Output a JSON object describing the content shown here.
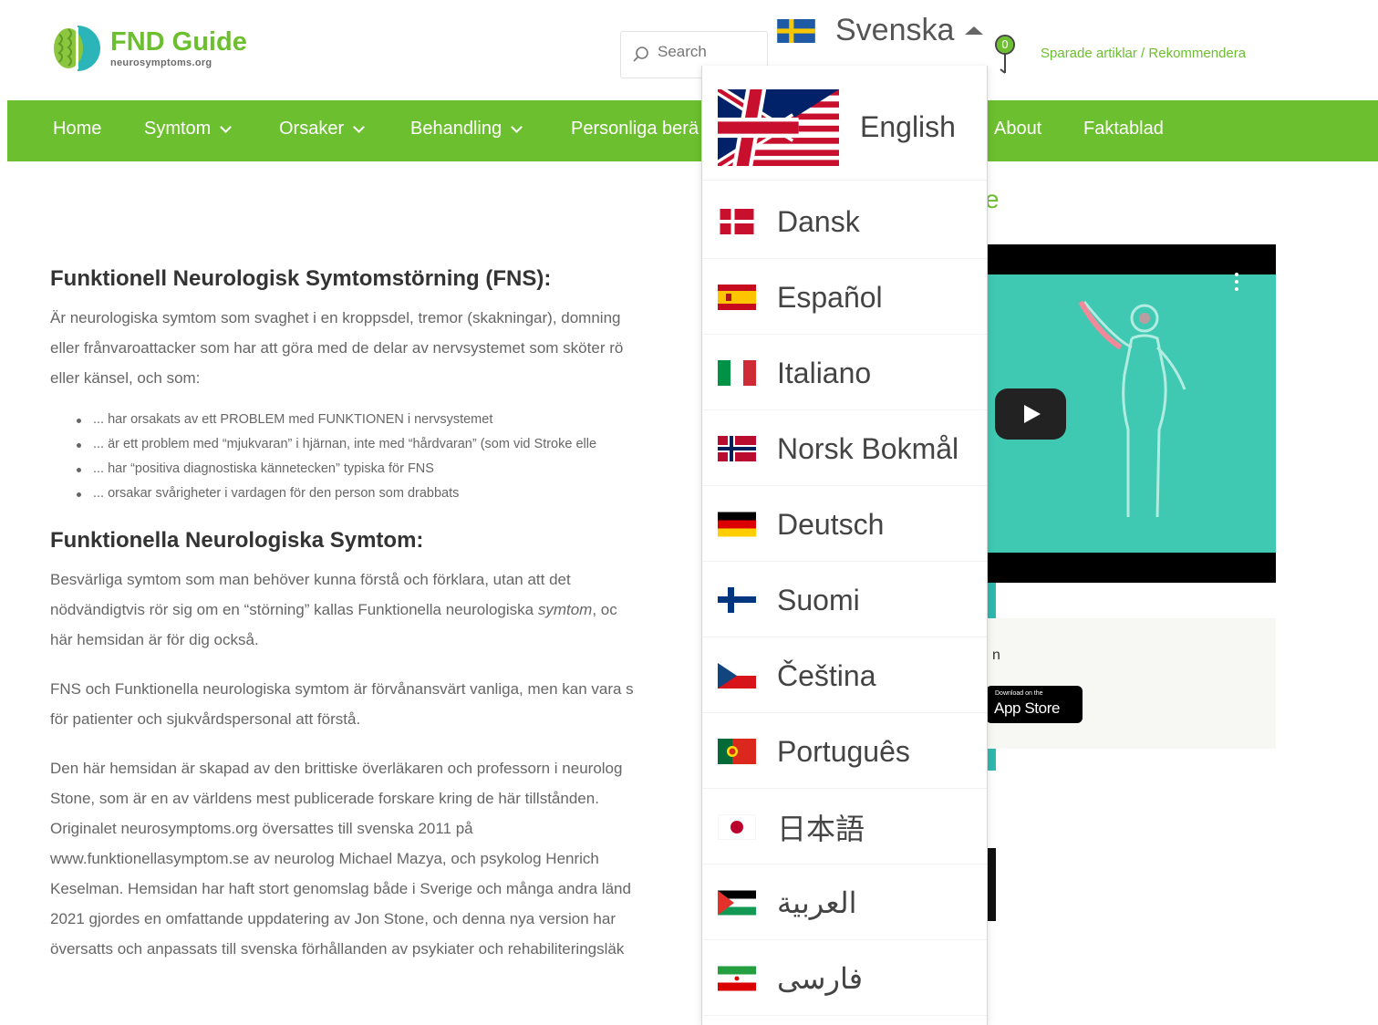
{
  "site": {
    "title": "FND Guide",
    "subtitle": "neurosymptoms.org"
  },
  "search": {
    "placeholder": "Search"
  },
  "language": {
    "current": "Svenska"
  },
  "header": {
    "saved_count": "0",
    "saved_link": "Sparade artiklar / Rekommendera"
  },
  "nav": {
    "home": "Home",
    "symptom": "Symtom",
    "orsaker": "Orsaker",
    "behandling": "Behandling",
    "personliga": "Personliga berä",
    "about": "About",
    "faktablad": "Faktablad"
  },
  "content": {
    "h1": "Funktionell Neurologisk Symtomstörning (FNS):",
    "p1_l1": "Är neurologiska symtom som svaghet i en kroppsdel, tremor (skakningar), domning",
    "p1_l2": "eller frånvaroattacker som har att göra med de delar av nervsystemet som sköter rö",
    "p1_l3": "eller känsel, och som:",
    "bullets": [
      "... har orsakats av ett PROBLEM med FUNKTIONEN i nervsystemet",
      "... är ett problem med “mjukvaran” i hjärnan, inte med “hårdvaran” (som vid Stroke elle",
      "... har “positiva diagnostiska kännetecken” typiska för FNS",
      "... orsakar svårigheter i vardagen för den person som drabbats"
    ],
    "h2": "Funktionella Neurologiska Symtom:",
    "p2_l1": "Besvärliga symtom som man behöver kunna förstå och förklara, utan att det",
    "p2_l2a": "nödvändigtvis rör sig om en “störning” kallas Funktionella neurologiska ",
    "p2_l2em": "symtom",
    "p2_l2b": ", oc",
    "p2_l3": "här hemsidan är för dig också.",
    "p3_l1": "FNS och Funktionella neurologiska symtom är förvånansvärt vanliga, men kan vara s",
    "p3_l2": "för patienter och sjukvårdspersonal att förstå.",
    "p4_l1": "Den här hemsidan är skapad av den brittiske överläkaren och professorn i neurolog",
    "p4_l2": "Stone, som är en av världens mest publicerade forskare kring de här tillstånden.",
    "p4_l3": "Originalet neurosymptoms.org översattes till svenska 2011 på",
    "p4_l4": "www.funktionellasymptom.se av neurolog Michael Mazya, och psykolog Henrich",
    "p4_l5": "Keselman. Hemsidan har haft stort genomslag både i Sverige och många andra länd",
    "p4_l6": "2021 gjordes en omfattande uppdatering av Jon Stone, och denna nya version har",
    "p4_l7": "översatts och anpassats till svenska förhållanden av psykiater och rehabiliteringsläk"
  },
  "sidebar": {
    "partial_title": "e",
    "app_partial": "n",
    "appstore_small": "Download on the",
    "appstore_big": "App Store"
  },
  "dropdown": {
    "english": "English",
    "dansk": "Dansk",
    "espanol": "Español",
    "italiano": "Italiano",
    "norsk": "Norsk Bokmål",
    "deutsch": "Deutsch",
    "suomi": "Suomi",
    "cestina": "Čeština",
    "portugues": "Português",
    "japanese": "日本語",
    "arabic": "العربية",
    "farsi": "فارسی"
  },
  "colors": {
    "brand_green": "#6cbf2e",
    "video_teal": "#3fc8b2"
  }
}
